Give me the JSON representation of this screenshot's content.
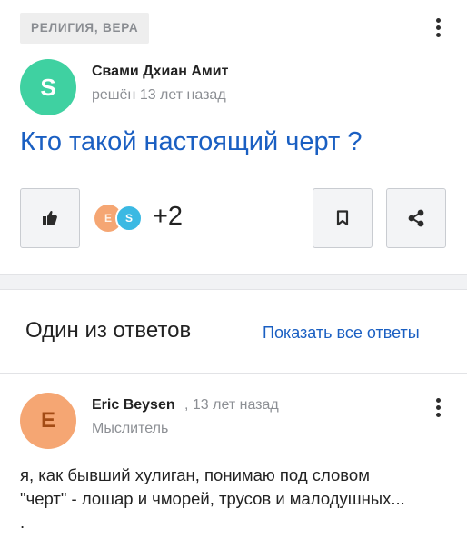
{
  "question_card": {
    "category_tag": "РЕЛИГИЯ, ВЕРА",
    "avatar_letter": "S",
    "author_name": "Свами Дхиан Амит",
    "meta": "решён 13 лет назад",
    "question_title": "Кто такой настоящий черт ?",
    "participants": [
      "E",
      "S"
    ],
    "participants_more": "+2"
  },
  "answers": {
    "header": "Один из ответов",
    "show_all_link": "Показать все ответы",
    "first": {
      "avatar_letter": "E",
      "author_name": "Eric Beysen",
      "time": ", 13 лет назад",
      "role": "Мыслитель",
      "text_line1": "я, как бывший хулиган, понимаю под словом",
      "text_line2": "\"черт\" - лошар и чморей, трусов и малодушных...",
      "text_line3": "."
    }
  },
  "colors": {
    "link_blue": "#1a5fc2",
    "avatar_green": "#3fd1a1",
    "avatar_orange": "#f5a673",
    "avatar_blue": "#3bb9e3"
  },
  "icons": [
    "kebab-menu-icon",
    "thumbs-up-icon",
    "bookmark-icon",
    "share-icon"
  ]
}
